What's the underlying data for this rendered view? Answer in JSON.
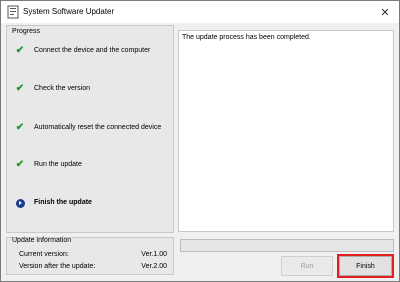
{
  "window": {
    "title": "System Software Updater",
    "close_icon": "close-icon"
  },
  "progress": {
    "legend": "Progress",
    "steps": [
      {
        "label": "Connect the device and the computer",
        "status": "done"
      },
      {
        "label": "Check the version",
        "status": "done"
      },
      {
        "label": "Automatically reset the connected device",
        "status": "done"
      },
      {
        "label": "Run the update",
        "status": "done"
      },
      {
        "label": "Finish the update",
        "status": "current"
      }
    ]
  },
  "log": {
    "text": "The update process has been completed."
  },
  "update_info": {
    "legend": "Update information",
    "current_version_label": "Current version:",
    "current_version_value": "Ver.1.00",
    "after_version_label": "Version after the update:",
    "after_version_value": "Ver.2.00"
  },
  "buttons": {
    "run": "Run",
    "finish": "Finish"
  },
  "colors": {
    "check": "#1e9a2c",
    "current_bullet": "#1a3d8f",
    "highlight": "#e0201e"
  }
}
